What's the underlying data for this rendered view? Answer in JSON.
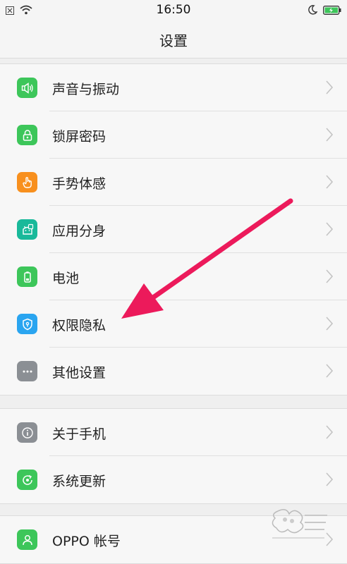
{
  "status_bar": {
    "time": "16:50",
    "left_icons": [
      "notification-icon",
      "wifi-icon"
    ],
    "right_icons": [
      "moon-icon",
      "battery-charging-icon"
    ]
  },
  "header": {
    "title": "设置"
  },
  "groups": [
    {
      "items": [
        {
          "label": "声音与振动",
          "icon": "speaker-icon",
          "color": "#3dc65a"
        },
        {
          "label": "锁屏密码",
          "icon": "lock-icon",
          "color": "#3dc65a"
        },
        {
          "label": "手势体感",
          "icon": "hand-icon",
          "color": "#f8901e"
        },
        {
          "label": "应用分身",
          "icon": "app-clone-icon",
          "color": "#19b99a"
        },
        {
          "label": "电池",
          "icon": "battery-icon",
          "color": "#3dc65a"
        },
        {
          "label": "权限隐私",
          "icon": "shield-icon",
          "color": "#2aa5f0"
        },
        {
          "label": "其他设置",
          "icon": "more-icon",
          "color": "#8b8f94"
        }
      ]
    },
    {
      "items": [
        {
          "label": "关于手机",
          "icon": "info-icon",
          "color": "#8b8f94"
        },
        {
          "label": "系统更新",
          "icon": "update-icon",
          "color": "#3dc65a"
        }
      ]
    },
    {
      "items": [
        {
          "label": "OPPO 帐号",
          "icon": "account-icon",
          "color": "#3dc65a"
        }
      ]
    }
  ],
  "annotation": {
    "arrow_color": "#ec1a5b",
    "points_to": "权限隐私"
  },
  "watermark": {
    "name": "baidu-jingyan-watermark"
  }
}
